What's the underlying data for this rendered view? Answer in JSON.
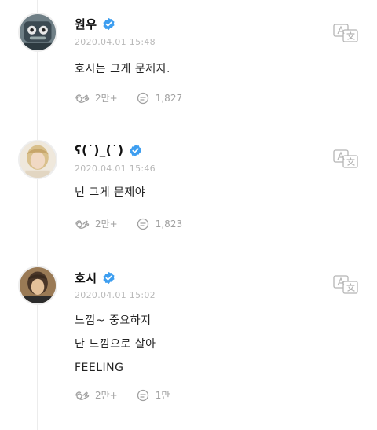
{
  "posts": [
    {
      "author": "원우",
      "timestamp": "2020.04.01 15:48",
      "lines": [
        "호시는 그게 문제지."
      ],
      "likes": "2만+",
      "comments": "1,827"
    },
    {
      "author": "ʕ(˙)_(˙)",
      "timestamp": "2020.04.01 15:46",
      "lines": [
        "넌 그게 문제야"
      ],
      "likes": "2만+",
      "comments": "1,823"
    },
    {
      "author": "호시",
      "timestamp": "2020.04.01 15:02",
      "lines": [
        "느낌~ 중요하지",
        "난 느낌으로 살아",
        "FEELING"
      ],
      "likes": "2만+",
      "comments": "1만"
    }
  ],
  "icons": {
    "verified": "verified-badge-icon",
    "like": "like-icon",
    "comment": "comment-icon",
    "translate": "translate-icon"
  },
  "colors": {
    "verified": "#3d9ef0",
    "stat_text": "#a0a0a0",
    "timestamp": "#b8b8b8"
  }
}
